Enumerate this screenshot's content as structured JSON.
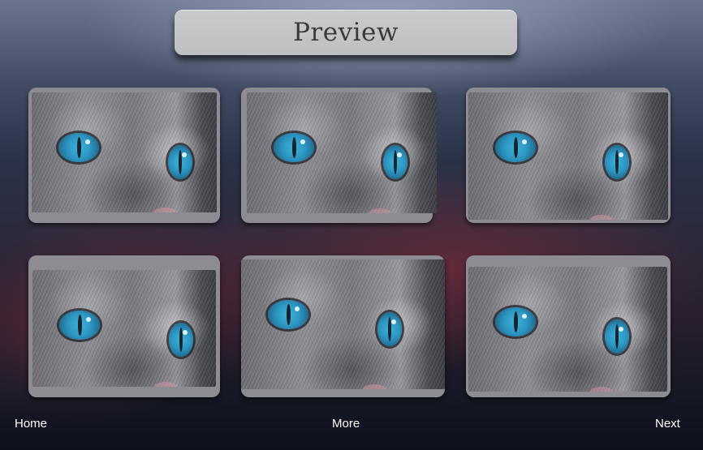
{
  "header": {
    "title": "Preview"
  },
  "gallery": {
    "items": [
      {
        "image": "cat-eyes-photo"
      },
      {
        "image": "cat-eyes-photo"
      },
      {
        "image": "cat-eyes-photo"
      },
      {
        "image": "cat-eyes-photo"
      },
      {
        "image": "cat-eyes-photo"
      },
      {
        "image": "cat-eyes-photo"
      }
    ]
  },
  "footer": {
    "home_label": "Home",
    "more_label": "More",
    "next_label": "Next"
  },
  "colors": {
    "title_bar": "#c4c4c6",
    "card_frame": "#8e8c93",
    "eye_blue": "#2d97c4",
    "nav_text": "#ffffff"
  }
}
